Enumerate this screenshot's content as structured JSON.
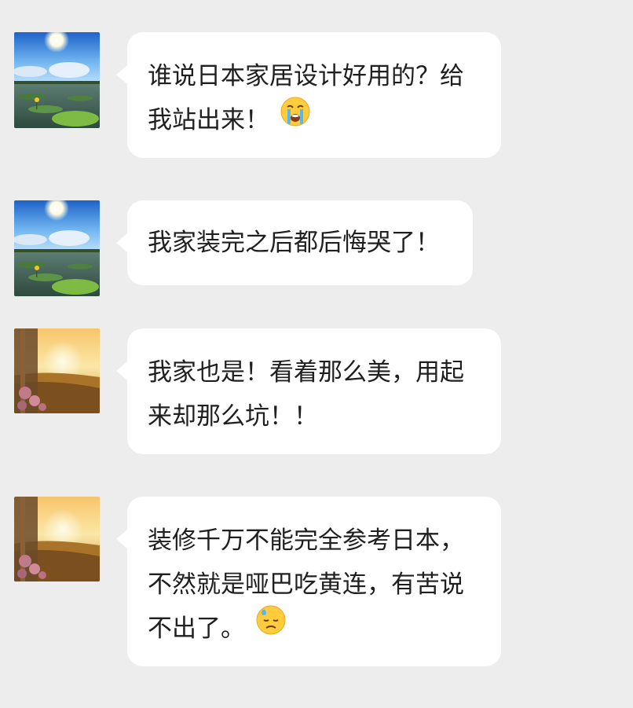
{
  "chat": {
    "messages": [
      {
        "avatar": "avatar-lotus-pond",
        "lines": [
          "谁说日本家居设计好用的？给",
          "我站出来！"
        ],
        "emoji": "loudly-crying-face-icon"
      },
      {
        "avatar": "avatar-lotus-pond",
        "lines": [
          "我家装完之后都后悔哭了！"
        ],
        "emoji": ""
      },
      {
        "avatar": "avatar-sunset-field",
        "lines": [
          "我家也是！看着那么美，用起",
          "来却那么坑！！"
        ],
        "emoji": ""
      },
      {
        "avatar": "avatar-sunset-field",
        "lines": [
          "装修千万不能完全参考日本，",
          "不然就是哑巴吃黄连，有苦说",
          "不出了。"
        ],
        "emoji": "downcast-face-with-sweat-icon"
      }
    ]
  },
  "colors": {
    "background": "#ededed",
    "bubble": "#ffffff",
    "text": "#1f1f1f"
  }
}
